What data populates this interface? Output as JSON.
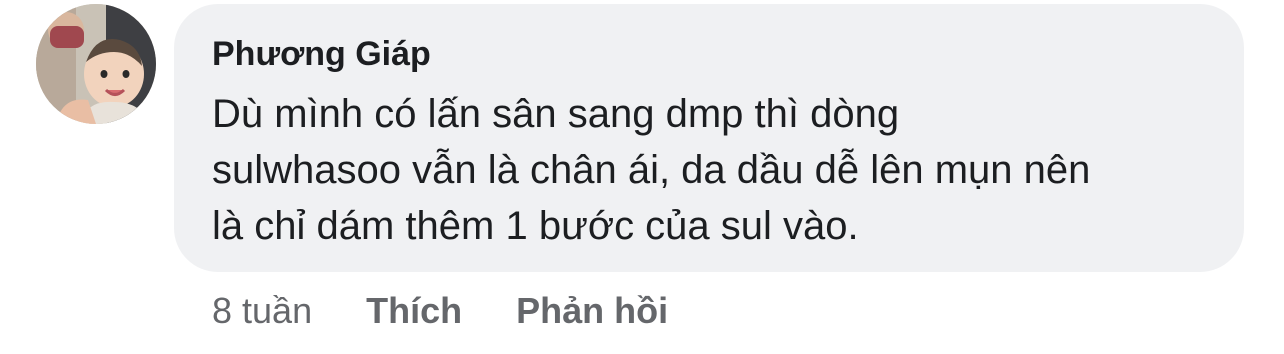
{
  "comment": {
    "author": "Phương Giáp",
    "text_lines": [
      "Dù mình có lấn sân sang dmp thì dòng",
      "sulwhasoo vẫn là chân ái, da dầu dễ lên mụn nên",
      "là chỉ dám thêm 1 bước của sul vào."
    ],
    "avatar_icon": "profile-photo-avatar"
  },
  "actions": {
    "timestamp": "8 tuần",
    "like_label": "Thích",
    "reply_label": "Phản hồi"
  },
  "colors": {
    "bubble_background": "#f0f1f3",
    "text_primary": "#1c1e21",
    "text_secondary": "#65676b"
  }
}
